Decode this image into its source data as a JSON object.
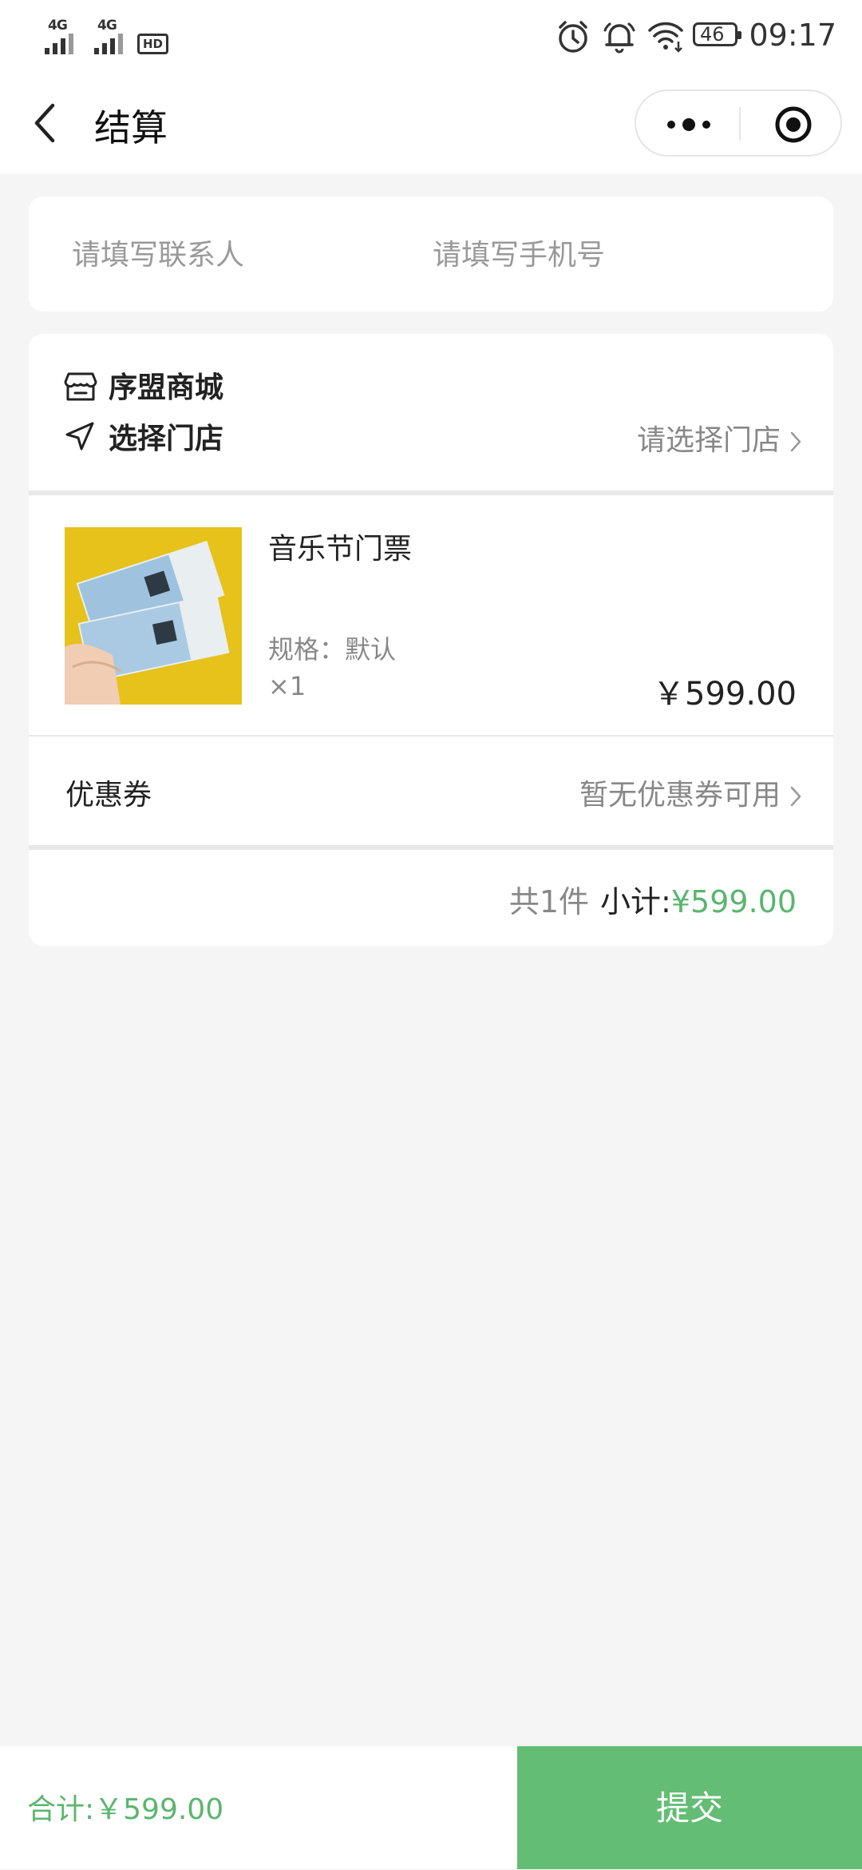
{
  "status_bar": {
    "network1": "4G",
    "network2": "4G",
    "hd": "HD",
    "battery": "46",
    "time": "09:17"
  },
  "nav": {
    "title": "结算"
  },
  "contact": {
    "name_placeholder": "请填写联系人",
    "phone_placeholder": "请填写手机号"
  },
  "shop": {
    "name": "序盟商城",
    "store_label": "选择门店",
    "store_placeholder": "请选择门店"
  },
  "product": {
    "name": "音乐节门票",
    "spec": "规格：默认",
    "qty": "×1",
    "price": "￥599.00",
    "image_colors": {
      "background": "#e6c21a",
      "ticket": "#9fc3de"
    }
  },
  "coupon": {
    "label": "优惠券",
    "value": "暂无优惠券可用"
  },
  "summary": {
    "count": "共1件",
    "label": "小计:",
    "amount": "¥599.00"
  },
  "footer": {
    "total": "合计:￥599.00",
    "submit": "提交"
  },
  "colors": {
    "accent": "#63bd74",
    "price_green": "#5ab66e",
    "background": "#f5f5f5"
  }
}
